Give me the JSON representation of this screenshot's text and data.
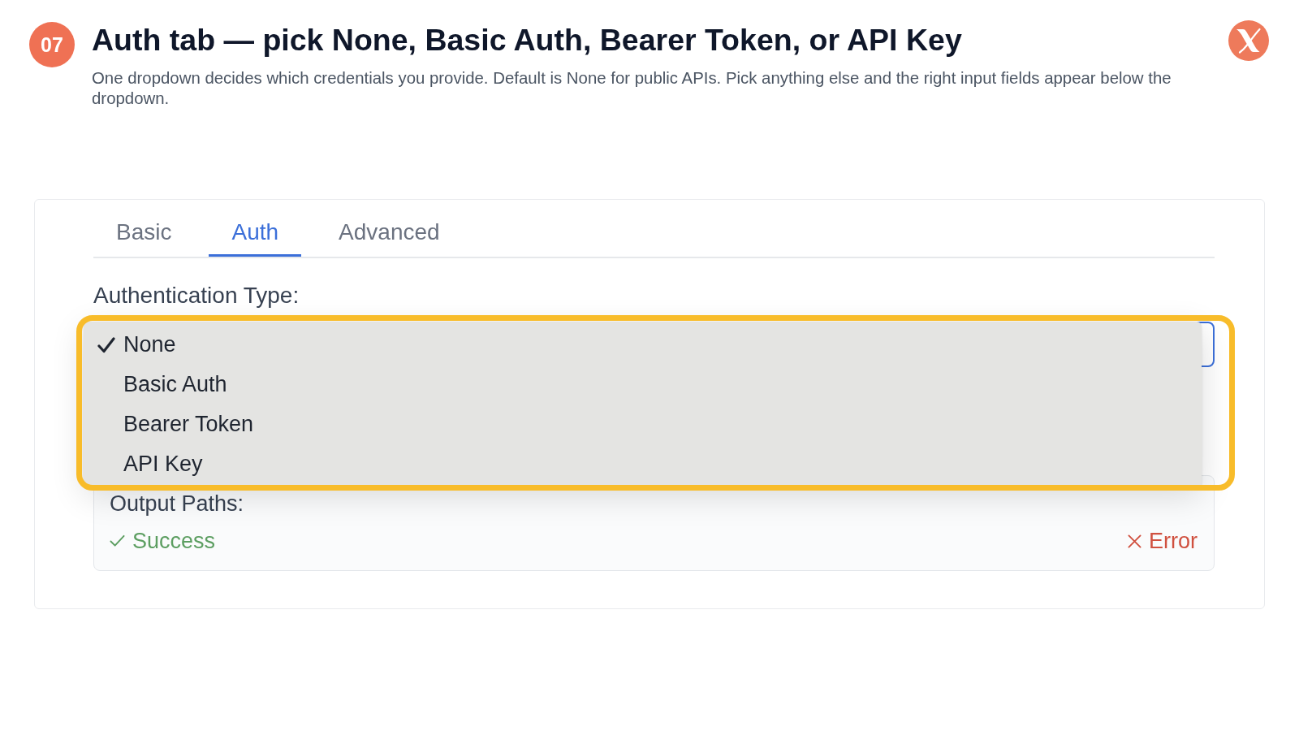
{
  "step": {
    "number": "07",
    "title": "Auth tab — pick None, Basic Auth, Bearer Token, or API Key",
    "description": "One dropdown decides which credentials you provide. Default is None for public APIs. Pick anything else and the right input fields appear below the dropdown."
  },
  "tabs": [
    {
      "label": "Basic",
      "selected": false
    },
    {
      "label": "Auth",
      "selected": true
    },
    {
      "label": "Advanced",
      "selected": false
    }
  ],
  "authentication": {
    "label": "Authentication Type:",
    "focused": true,
    "menu_open": true,
    "highlighted": true,
    "options": [
      {
        "label": "None",
        "selected": true
      },
      {
        "label": "Basic Auth",
        "selected": false
      },
      {
        "label": "Bearer Token",
        "selected": false
      },
      {
        "label": "API Key",
        "selected": false
      }
    ]
  },
  "output_paths": {
    "label": "Output Paths:",
    "paths": [
      {
        "kind": "success",
        "label": "Success"
      },
      {
        "kind": "error",
        "label": "Error"
      }
    ]
  }
}
